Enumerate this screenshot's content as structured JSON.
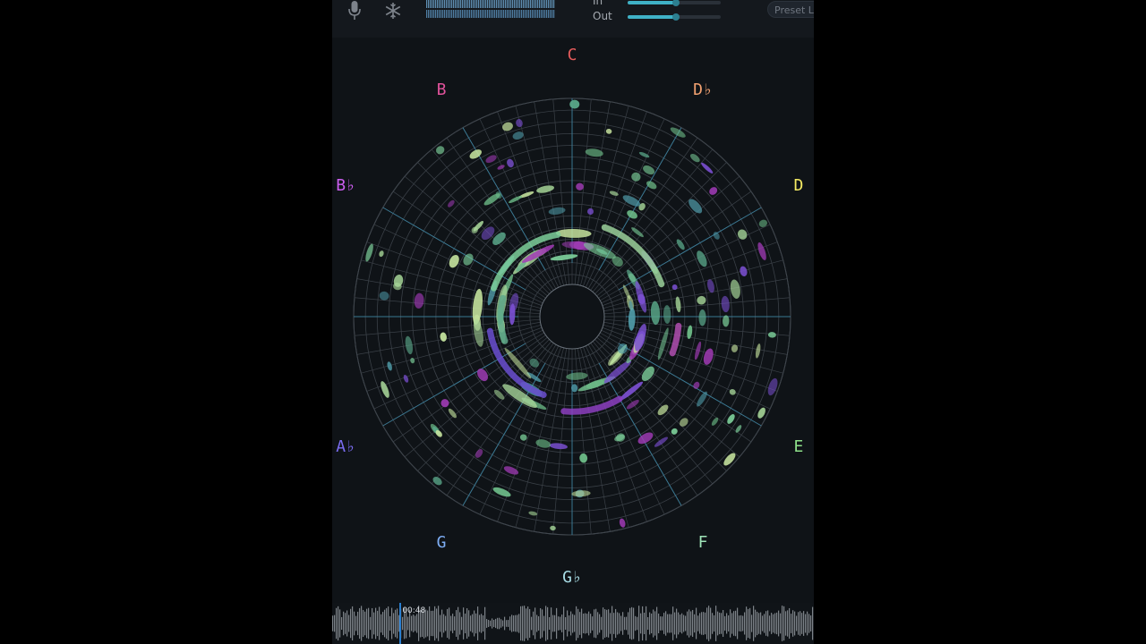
{
  "topbar": {
    "mic_icon": "microphone-icon",
    "freeze_icon": "snowflake-icon",
    "in_label": "In",
    "out_label": "Out",
    "in_level": 0.52,
    "out_level": 0.52,
    "preset_label": "Preset Li"
  },
  "wheel": {
    "notes": [
      "C",
      "D♭",
      "D",
      "E",
      "F",
      "G♭",
      "G",
      "A♭",
      "B♭",
      "B"
    ],
    "note_colors": [
      "#e55b5b",
      "#f0a070",
      "#f4ea63",
      "#8ee08a",
      "#9fe4b8",
      "#a8dde6",
      "#7eaef5",
      "#7a6cf0",
      "#cc5ef0",
      "#e0529b"
    ],
    "accent": "#3fb1c6"
  },
  "timeline": {
    "time": "00:48",
    "position": 0.14
  }
}
